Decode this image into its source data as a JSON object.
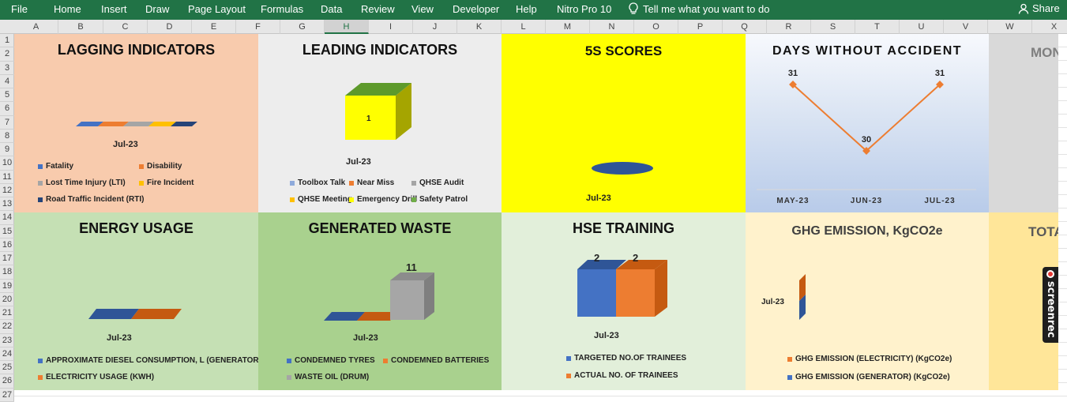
{
  "menu": {
    "items": [
      "File",
      "Home",
      "Insert",
      "Draw",
      "Page Layout",
      "Formulas",
      "Data",
      "Review",
      "View",
      "Developer",
      "Help",
      "Nitro Pro 10"
    ],
    "tell_me": "Tell me what you want to do",
    "share": "Share"
  },
  "columns": [
    "A",
    "B",
    "C",
    "D",
    "E",
    "F",
    "G",
    "H",
    "I",
    "J",
    "K",
    "L",
    "M",
    "N",
    "O",
    "P",
    "Q",
    "R",
    "S",
    "T",
    "U",
    "V",
    "W",
    "X"
  ],
  "selected_column": "H",
  "rows": [
    "1",
    "2",
    "3",
    "4",
    "5",
    "6",
    "7",
    "8",
    "9",
    "10",
    "11",
    "12",
    "13",
    "14",
    "15",
    "16",
    "17",
    "18",
    "19",
    "20",
    "21",
    "22",
    "23",
    "24",
    "25",
    "26",
    "27"
  ],
  "colors": {
    "ribbon": "#217346",
    "blue": "#4472c4",
    "orange": "#ed7d31",
    "gray": "#a5a5a5",
    "yellow": "#ffc000",
    "darkblue": "#264478",
    "green": "#70ad47"
  },
  "panels": {
    "lagging": {
      "title": "LAGGING INDICATORS",
      "period": "Jul-23",
      "legend": [
        "Fatality",
        "Disability",
        "Lost Time Injury  (LTI)",
        "Fire Incident",
        "Road Traffic Incident (RTI)"
      ]
    },
    "leading": {
      "title": "LEADING INDICATORS",
      "period": "Jul-23",
      "value_label": "1",
      "legend": [
        "Toolbox Talk",
        "Near Miss",
        "QHSE Audit",
        "QHSE Meeting",
        "Emergency Drill",
        "Safety Patrol"
      ]
    },
    "five_s": {
      "title": "5S SCORES",
      "period": "Jul-23"
    },
    "days": {
      "title": "DAYS WITHOUT ACCIDENT",
      "months": [
        "MAY-23",
        "JUN-23",
        "JUL-23"
      ],
      "data_labels": [
        "31",
        "30",
        "31"
      ]
    },
    "mon": {
      "title": "MON"
    },
    "energy": {
      "title": "ENERGY USAGE",
      "period": "Jul-23",
      "legend": [
        "APPROXIMATE DIESEL CONSUMPTION, L (GENERATOR)",
        "ELECTRICITY USAGE (KWH)"
      ]
    },
    "waste": {
      "title": "GENERATED WASTE",
      "period": "Jul-23",
      "value_label": "11",
      "legend": [
        "CONDEMNED TYRES",
        "CONDEMNED BATTERIES",
        "WASTE OIL (DRUM)"
      ]
    },
    "training": {
      "title": "HSE TRAINING",
      "period": "Jul-23",
      "value_labels": [
        "2",
        "2"
      ],
      "legend": [
        "TARGETED NO.OF TRAINEES",
        "ACTUAL NO. OF TRAINEES"
      ]
    },
    "ghg": {
      "title": "GHG EMISSION, KgCO2e",
      "period": "Jul-23",
      "legend": [
        "GHG EMISSION (ELECTRICITY) (KgCO2e)",
        "GHG EMISSION (GENERATOR) (KgCO2e)"
      ]
    },
    "tota": {
      "title": "TOTA"
    }
  },
  "chart_data": [
    {
      "type": "bar",
      "title": "LAGGING INDICATORS",
      "categories": [
        "Jul-23"
      ],
      "series": [
        {
          "name": "Fatality",
          "values": [
            0
          ]
        },
        {
          "name": "Disability",
          "values": [
            0
          ]
        },
        {
          "name": "Lost Time Injury  (LTI)",
          "values": [
            0
          ]
        },
        {
          "name": "Fire Incident",
          "values": [
            0
          ]
        },
        {
          "name": "Road Traffic Incident (RTI)",
          "values": [
            0
          ]
        }
      ]
    },
    {
      "type": "bar",
      "title": "LEADING INDICATORS",
      "categories": [
        "Jul-23"
      ],
      "series": [
        {
          "name": "Toolbox Talk",
          "values": [
            0
          ]
        },
        {
          "name": "Near Miss",
          "values": [
            0
          ]
        },
        {
          "name": "QHSE Audit",
          "values": [
            0
          ]
        },
        {
          "name": "QHSE Meeting",
          "values": [
            0
          ]
        },
        {
          "name": "Emergency Drill",
          "values": [
            1
          ]
        },
        {
          "name": "Safety Patrol",
          "values": [
            0
          ]
        }
      ]
    },
    {
      "type": "line",
      "title": "DAYS WITHOUT ACCIDENT",
      "x": [
        "MAY-23",
        "JUN-23",
        "JUL-23"
      ],
      "series": [
        {
          "values": [
            31,
            30,
            31
          ]
        }
      ]
    },
    {
      "type": "bar",
      "title": "ENERGY USAGE",
      "categories": [
        "Jul-23"
      ],
      "series": [
        {
          "name": "APPROXIMATE DIESEL CONSUMPTION, L (GENERATOR)",
          "values": [
            0
          ]
        },
        {
          "name": "ELECTRICITY USAGE (KWH)",
          "values": [
            0
          ]
        }
      ]
    },
    {
      "type": "bar",
      "title": "GENERATED WASTE",
      "categories": [
        "Jul-23"
      ],
      "series": [
        {
          "name": "CONDEMNED TYRES",
          "values": [
            0
          ]
        },
        {
          "name": "CONDEMNED BATTERIES",
          "values": [
            0
          ]
        },
        {
          "name": "WASTE OIL (DRUM)",
          "values": [
            11
          ]
        }
      ]
    },
    {
      "type": "bar",
      "title": "HSE TRAINING",
      "categories": [
        "Jul-23"
      ],
      "series": [
        {
          "name": "TARGETED NO.OF TRAINEES",
          "values": [
            2
          ]
        },
        {
          "name": "ACTUAL NO. OF TRAINEES",
          "values": [
            2
          ]
        }
      ]
    }
  ]
}
